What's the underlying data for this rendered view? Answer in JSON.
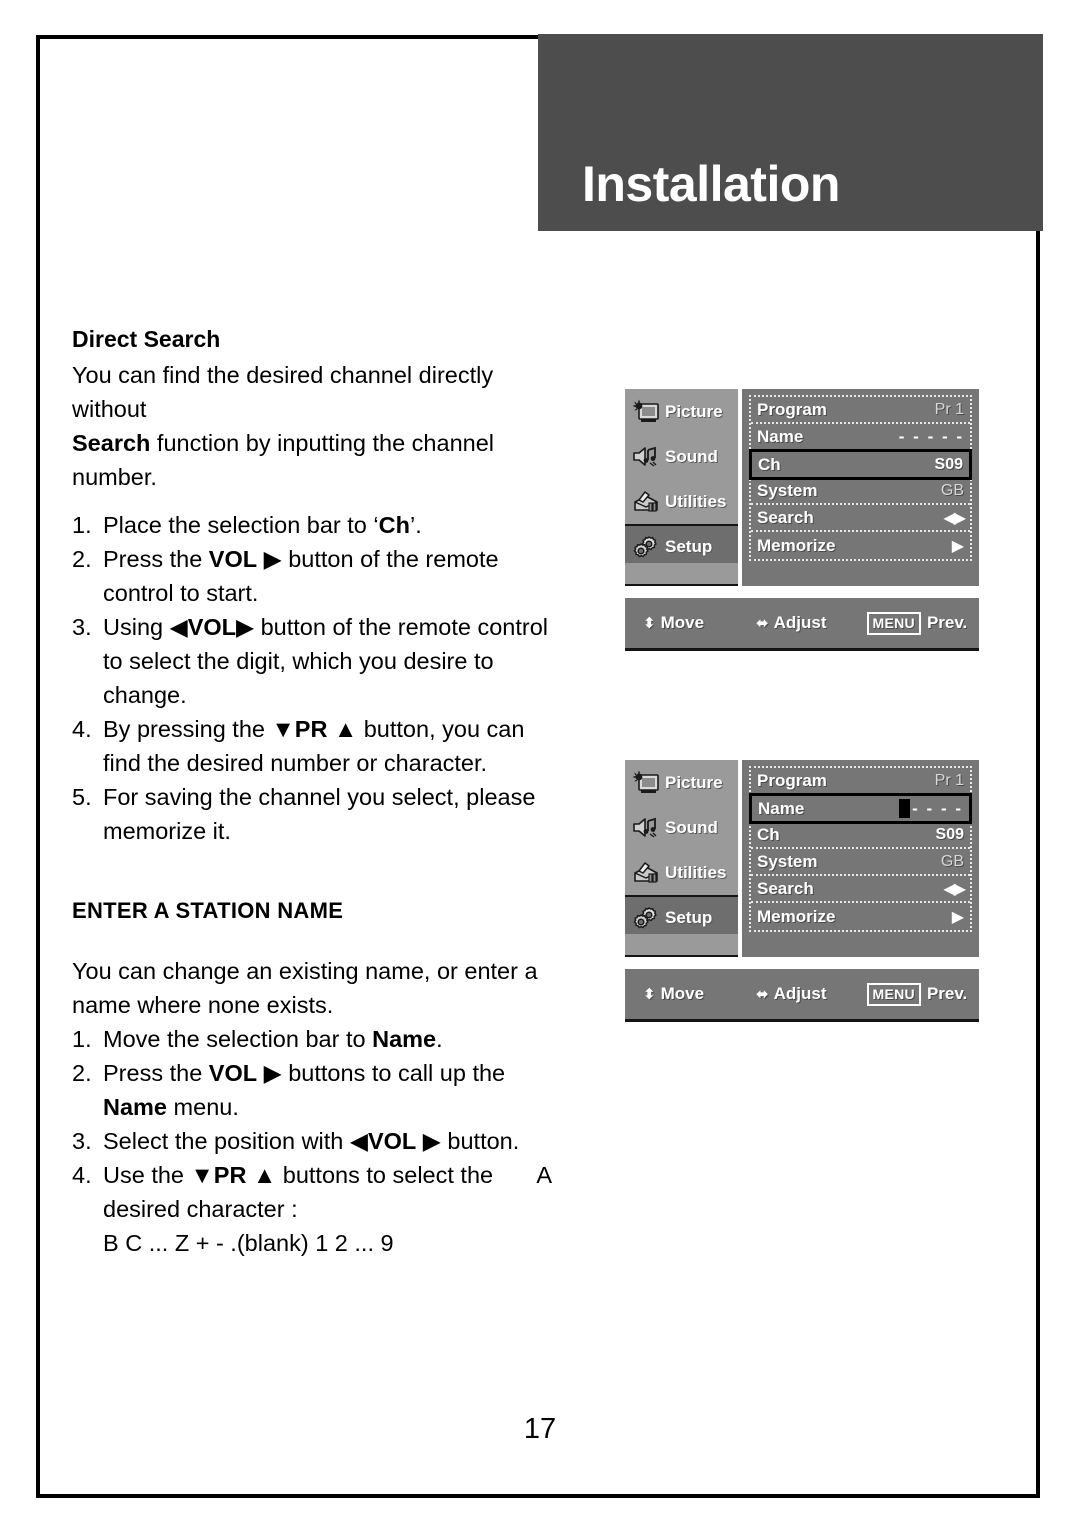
{
  "header": {
    "title": "Installation"
  },
  "page": {
    "number": "17"
  },
  "sections": [
    {
      "heading": "Direct Search",
      "intro_line_1_a": "You can find the desired channel directly without",
      "intro_line_2_a": "Search",
      "intro_line_2_b": " function by inputting the channel number.",
      "steps": [
        {
          "num": "1.",
          "parts": [
            "Place the selection bar to ‘",
            "Ch",
            "’."
          ]
        },
        {
          "num": "2.",
          "parts": [
            "Press the ",
            "VOL",
            " ▶ button of the remote control to start."
          ]
        },
        {
          "num": "3.",
          "parts": [
            "Using  ◀",
            "VOL",
            "▶ button of the remote control to select the digit, which you desire to change."
          ]
        },
        {
          "num": "4.",
          "parts": [
            "By pressing the  ▼",
            "PR",
            " ▲ button, you can find the desired number or character."
          ]
        },
        {
          "num": "5.",
          "parts": [
            "For saving the channel you select, please memorize it."
          ]
        }
      ]
    },
    {
      "heading": "ENTER A STATION NAME",
      "intro": "You can change an existing name, or enter a name where none exists.",
      "steps": [
        {
          "num": "1.",
          "parts": [
            "Move the selection bar to ",
            "Name",
            "."
          ]
        },
        {
          "num": "2.",
          "parts": [
            "Press the ",
            "VOL",
            " ▶ buttons to call up the ",
            "Name",
            " menu."
          ]
        },
        {
          "num": "3.",
          "parts": [
            "Select the position with  ◀",
            "VOL",
            " ▶ button."
          ]
        },
        {
          "num": "4.",
          "parts": [
            "Use the  ▼",
            "PR",
            " ▲ buttons to select the desired character :"
          ]
        }
      ],
      "character_first": "A",
      "character_rest": "B C ... Z + - .(blank) 1 2 ... 9"
    }
  ],
  "osd": {
    "sidebar": [
      {
        "label": "Picture",
        "icon": "picture-icon",
        "active": false
      },
      {
        "label": "Sound",
        "icon": "sound-icon",
        "active": false
      },
      {
        "label": "Utilities",
        "icon": "utilities-icon",
        "active": false
      },
      {
        "label": "Setup",
        "icon": "setup-icon",
        "active": true
      }
    ],
    "status": {
      "move_label": "Move",
      "move_glyph": "⬍",
      "adjust_label": "Adjust",
      "adjust_glyph": "⬌",
      "menu_label": "MENU",
      "prev_label": "Prev."
    },
    "menus": [
      {
        "name": "direct-search-menu",
        "rows": [
          {
            "label": "Program",
            "value": "Pr 1",
            "type": "text",
            "dim": true,
            "selected": false
          },
          {
            "label": "Name",
            "value": "- - - - -",
            "type": "dashes",
            "selected": false
          },
          {
            "label": "Ch",
            "value": "S09",
            "type": "text",
            "dim": false,
            "selected": true
          },
          {
            "label": "System",
            "value": "GB",
            "type": "text",
            "dim": true,
            "selected": false
          },
          {
            "label": "Search",
            "value": "◀▶",
            "type": "arrow-lr",
            "selected": false
          },
          {
            "label": "Memorize",
            "value": "▶",
            "type": "arrow-r",
            "selected": false
          }
        ]
      },
      {
        "name": "station-name-menu",
        "rows": [
          {
            "label": "Program",
            "value": "Pr 1",
            "type": "text",
            "dim": true,
            "selected": false
          },
          {
            "label": "Name",
            "value": "- - - -",
            "type": "cursor-dashes",
            "selected": true
          },
          {
            "label": "Ch",
            "value": "S09",
            "type": "text",
            "dim": false,
            "selected": false
          },
          {
            "label": "System",
            "value": "GB",
            "type": "text",
            "dim": true,
            "selected": false
          },
          {
            "label": "Search",
            "value": "◀▶",
            "type": "arrow-lr",
            "selected": false
          },
          {
            "label": "Memorize",
            "value": "▶",
            "type": "arrow-r",
            "selected": false
          }
        ]
      }
    ]
  },
  "colors": {
    "header_band": "#4d4d4d",
    "osd_panel": "#767676",
    "osd_sidebar": "#9a9a9a",
    "osd_active": "#6e6e6e",
    "page_border": "#000000"
  }
}
